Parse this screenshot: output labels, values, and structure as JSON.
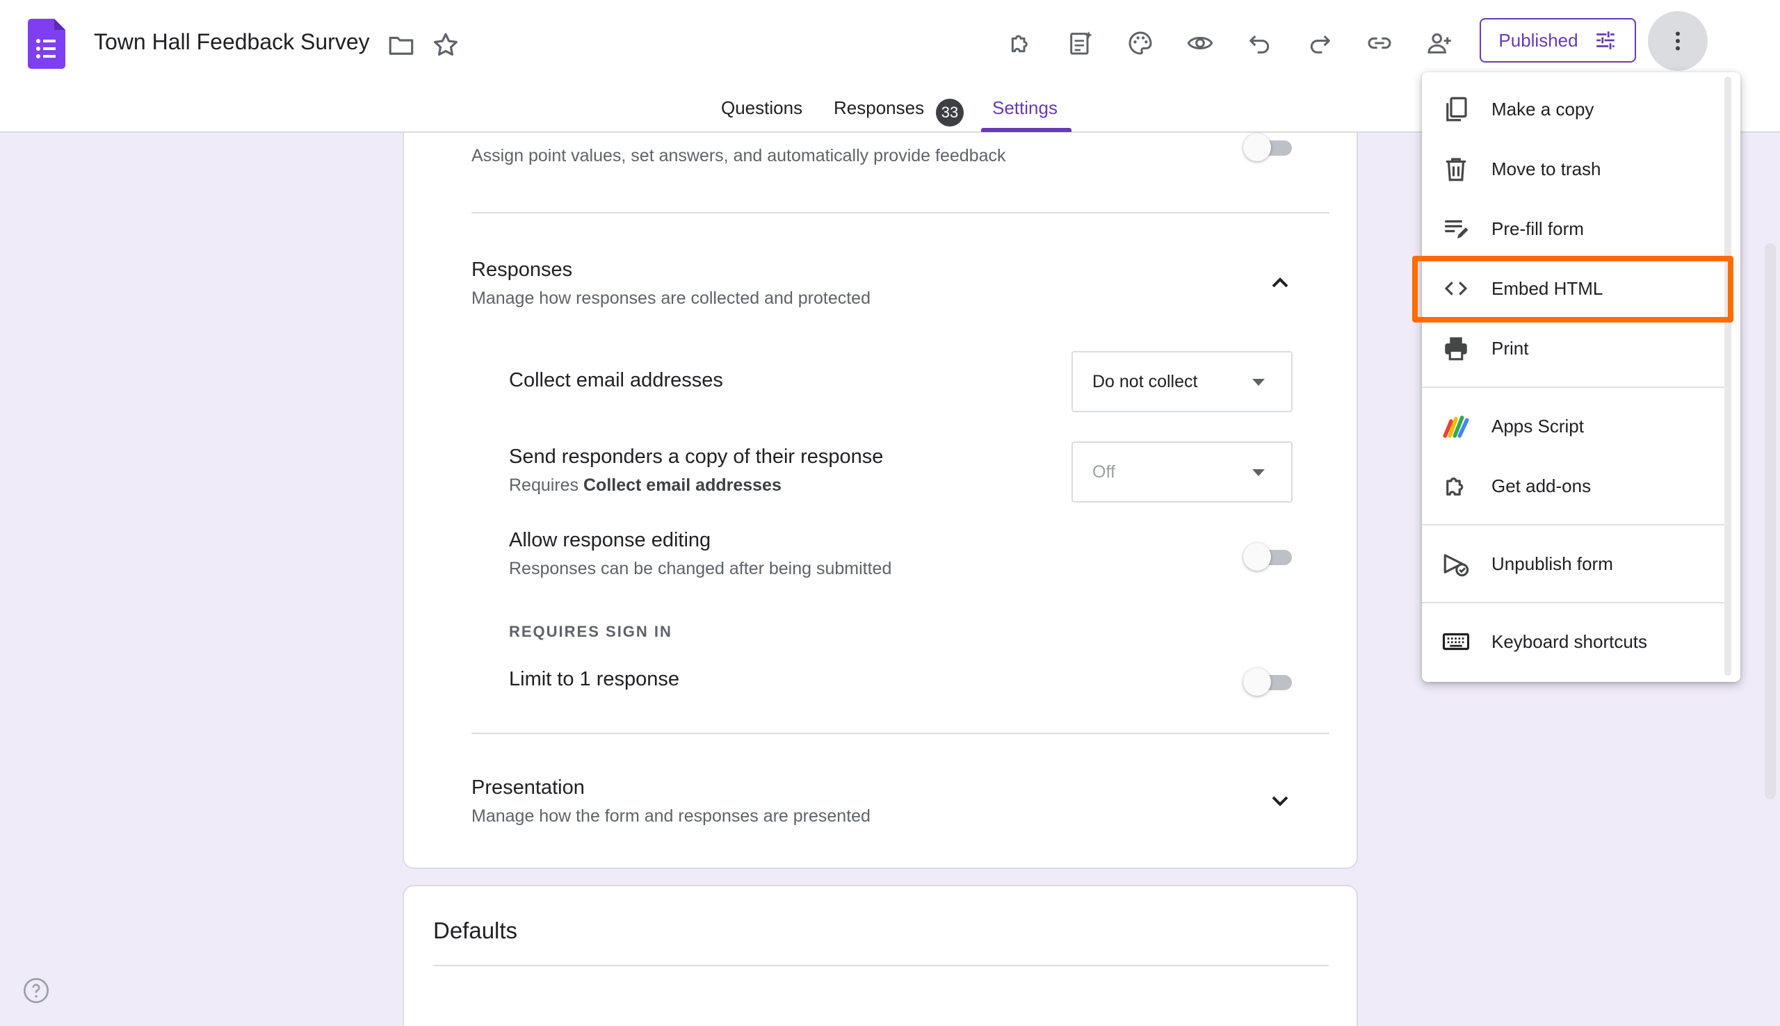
{
  "header": {
    "title": "Town Hall Feedback Survey",
    "publish_label": "Published"
  },
  "tabs": {
    "questions": "Questions",
    "responses": "Responses",
    "responses_count": "33",
    "settings": "Settings"
  },
  "quizzes": {
    "description": "Assign point values, set answers, and automatically provide feedback"
  },
  "responses_section": {
    "title": "Responses",
    "description": "Manage how responses are collected and protected",
    "collect_email_label": "Collect email addresses",
    "collect_email_value": "Do not collect",
    "send_copy_label": "Send responders a copy of their response",
    "send_copy_requires_prefix": "Requires ",
    "send_copy_requires_bold": "Collect email addresses",
    "send_copy_value": "Off",
    "allow_edit_label": "Allow response editing",
    "allow_edit_description": "Responses can be changed after being submitted",
    "requires_sign_in": "REQUIRES SIGN IN",
    "limit_label": "Limit to 1 response"
  },
  "presentation": {
    "title": "Presentation",
    "description": "Manage how the form and responses are presented"
  },
  "defaults": {
    "title": "Defaults"
  },
  "menu": {
    "items": [
      {
        "label": "Make a copy",
        "icon": "copy-icon"
      },
      {
        "label": "Move to trash",
        "icon": "trash-icon"
      },
      {
        "label": "Pre-fill form",
        "icon": "prefill-icon"
      },
      {
        "label": "Embed HTML",
        "icon": "code-icon"
      },
      {
        "label": "Print",
        "icon": "print-icon"
      },
      {
        "label": "Apps Script",
        "icon": "apps-script-icon"
      },
      {
        "label": "Get add-ons",
        "icon": "puzzle-icon"
      },
      {
        "label": "Unpublish form",
        "icon": "unpublish-icon"
      },
      {
        "label": "Keyboard shortcuts",
        "icon": "keyboard-icon"
      }
    ]
  },
  "colors": {
    "accent": "#673ab7",
    "background": "#f0ebf8",
    "highlight": "#ff6d00"
  }
}
